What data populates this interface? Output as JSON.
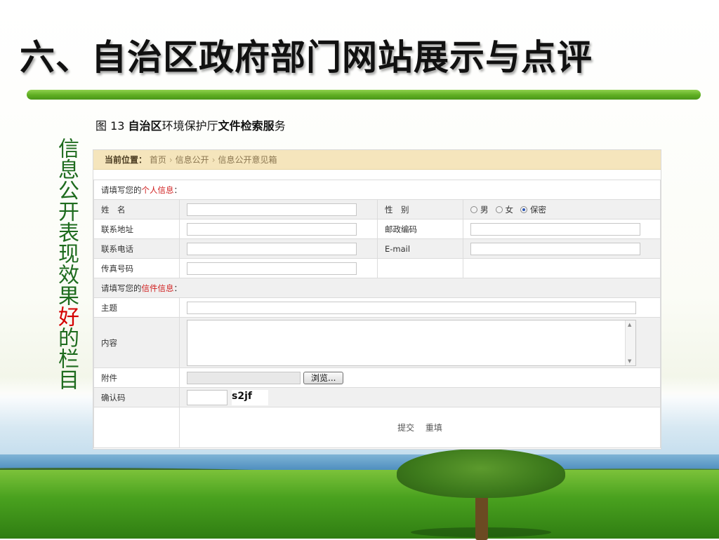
{
  "slide": {
    "title": "六、自治区政府部门网站展示与点评",
    "caption_parts": [
      {
        "text": "图 13 ",
        "bold": false
      },
      {
        "text": "自治区",
        "bold": true
      },
      {
        "text": "环境保护厅",
        "bold": false
      },
      {
        "text": "文件检索服",
        "bold": true
      },
      {
        "text": "务",
        "bold": false
      }
    ],
    "side_label_a": "信息公开表现效果",
    "side_label_hl": "好",
    "side_label_b": "的栏目",
    "colors": {
      "accent_green": "#5fae22",
      "side_text": "#1e6b1e",
      "highlight_red": "#d40000"
    }
  },
  "breadcrumb": {
    "label": "当前位置：",
    "items": [
      "首页",
      "信息公开",
      "信息公开意见箱"
    ],
    "separator": "›"
  },
  "form": {
    "personal_prefix": "请填写您的",
    "personal_red": "个人信息",
    "personal_suffix": "：",
    "name_label": "姓　名",
    "gender_label": "性　别",
    "gender_options": [
      "男",
      "女",
      "保密"
    ],
    "gender_selected": "保密",
    "address_label": "联系地址",
    "postcode_label": "邮政编码",
    "phone_label": "联系电话",
    "email_label": "E-mail",
    "fax_label": "传真号码",
    "letter_prefix": "请填写您的",
    "letter_red": "信件信息",
    "letter_suffix": "：",
    "subject_label": "主题",
    "content_label": "内容",
    "attachment_label": "附件",
    "browse_label": "浏览...",
    "captcha_label": "确认码",
    "captcha_value": "s2jf",
    "submit_label": "提交",
    "reset_label": "重填",
    "values": {
      "name": "",
      "address": "",
      "phone": "",
      "fax": "",
      "postcode": "",
      "email": "",
      "subject": "",
      "content": "",
      "captcha": ""
    }
  }
}
